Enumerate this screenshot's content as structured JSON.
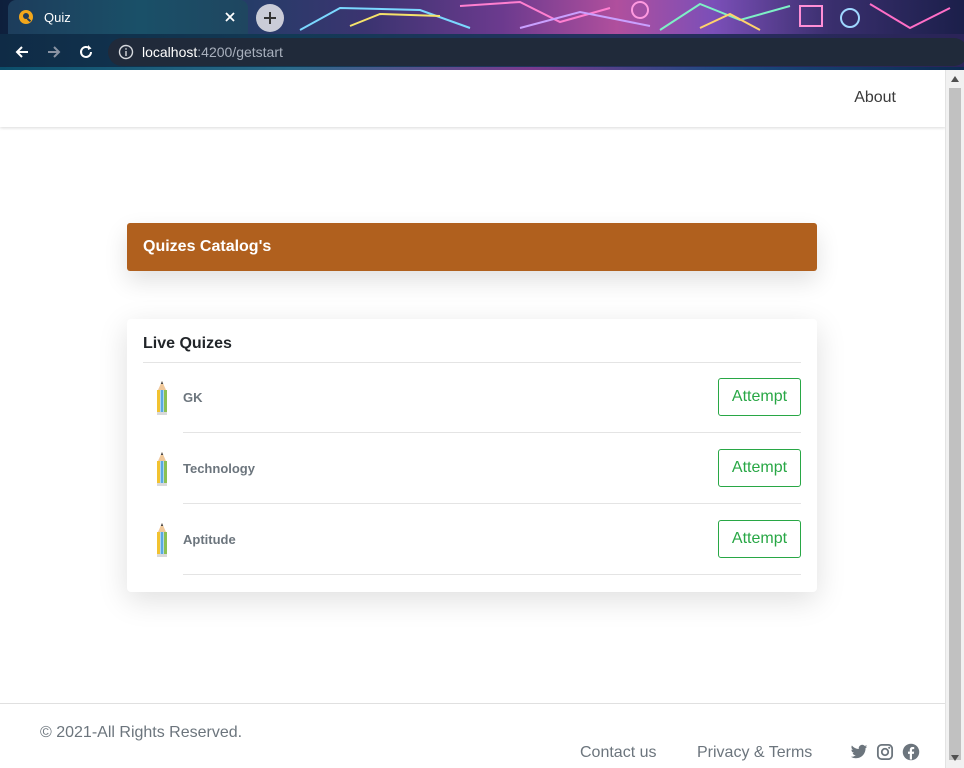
{
  "browser": {
    "tab_title": "Quiz",
    "url_host": "localhost",
    "url_path": ":4200/getstart",
    "icons": {
      "favicon": "quiz-app-icon",
      "close": "close-icon",
      "new_tab": "plus-icon",
      "back": "arrow-left-icon",
      "forward": "arrow-right-icon",
      "reload": "reload-icon",
      "site_info": "info-icon"
    }
  },
  "navbar": {
    "about_label": "About"
  },
  "catalog": {
    "title": "Quizes Catalog's",
    "color": "#b0601e"
  },
  "live_quizzes": {
    "title": "Live Quizes",
    "items": [
      {
        "name": "GK",
        "button_label": "Attempt",
        "icon": "pencil-icon"
      },
      {
        "name": "Technology",
        "button_label": "Attempt",
        "icon": "pencil-icon"
      },
      {
        "name": "Aptitude",
        "button_label": "Attempt",
        "icon": "pencil-icon"
      }
    ],
    "button_color": "#28a745"
  },
  "footer": {
    "copyright": "© 2021-All Rights Reserved.",
    "links": [
      "Contact us",
      "Privacy & Terms"
    ],
    "social_icons": [
      "twitter-icon",
      "instagram-icon",
      "facebook-icon"
    ]
  }
}
